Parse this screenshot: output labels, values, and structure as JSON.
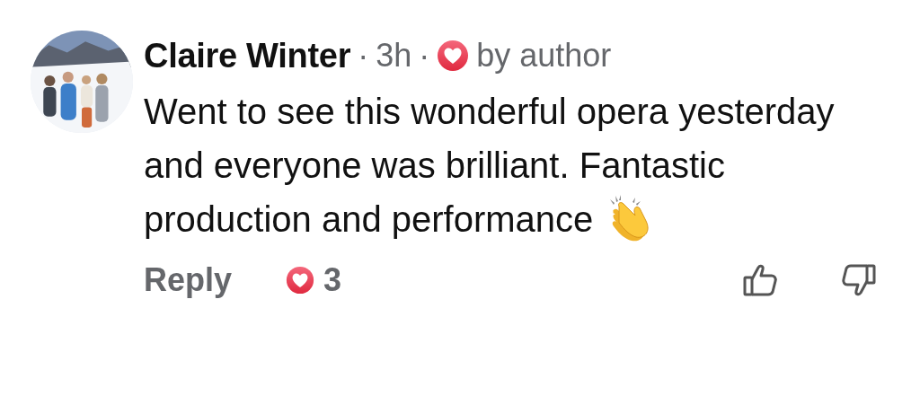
{
  "comment": {
    "author": "Claire Winter",
    "separator_1": "·",
    "time": "3h",
    "separator_2": "·",
    "author_reaction_label": "by author",
    "text": "Went to see this wonderful opera yesterday and everyone was brilliant. Fantastic production and performance",
    "reply_label": "Reply",
    "reaction_count": "3"
  }
}
